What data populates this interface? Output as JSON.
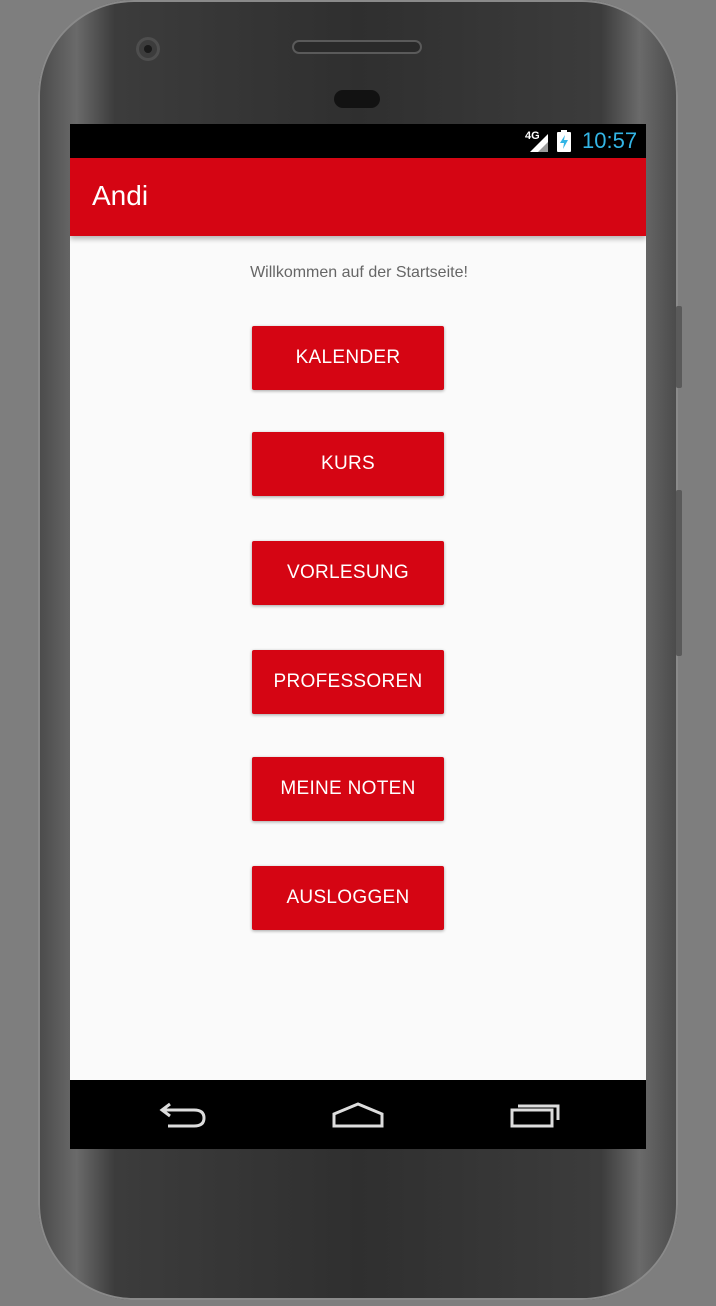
{
  "status_bar": {
    "network": "4G",
    "time": "10:57",
    "icons": [
      "signal-icon",
      "battery-charging-icon"
    ]
  },
  "app_bar": {
    "title": "Andi"
  },
  "main": {
    "welcome_text": "Willkommen auf der Startseite!",
    "buttons": [
      {
        "label": "KALENDER"
      },
      {
        "label": "KURS"
      },
      {
        "label": "VORLESUNG"
      },
      {
        "label": "PROFESSOREN"
      },
      {
        "label": "MEINE NOTEN"
      },
      {
        "label": "AUSLOGGEN"
      }
    ]
  },
  "nav_bar": {
    "icons": [
      "back-icon",
      "home-icon",
      "recents-icon"
    ]
  },
  "colors": {
    "primary": "#d50513",
    "status_time": "#33b5e5",
    "background": "#fafafa"
  }
}
